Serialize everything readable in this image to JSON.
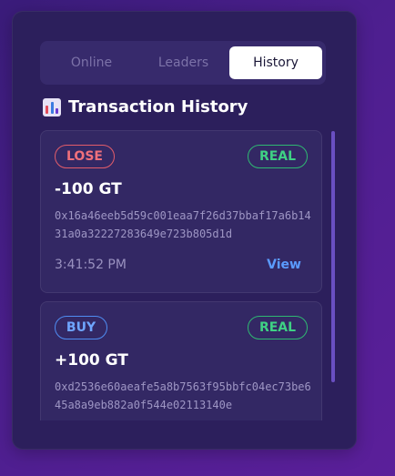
{
  "tabs": [
    {
      "label": "Online"
    },
    {
      "label": "Leaders"
    },
    {
      "label": "History"
    }
  ],
  "section": {
    "title": "Transaction History",
    "icon": "bar-chart-icon"
  },
  "transactions": [
    {
      "type": "LOSE",
      "mode": "REAL",
      "amount": "-100 GT",
      "hash": "0x16a46eeb5d59c001eaa7f26d37bbaf17a6b1431a0a32227283649e723b805d1d",
      "time": "3:41:52 PM",
      "action": "View"
    },
    {
      "type": "BUY",
      "mode": "REAL",
      "amount": "+100 GT",
      "hash": "0xd2536e60aeafe5a8b7563f95bbfc04ec73be645a8a9eb882a0f544e02113140e"
    }
  ],
  "colors": {
    "lose": "#f0707b",
    "buy": "#6fa6ff",
    "real": "#3fd184",
    "link": "#5b9bff"
  }
}
